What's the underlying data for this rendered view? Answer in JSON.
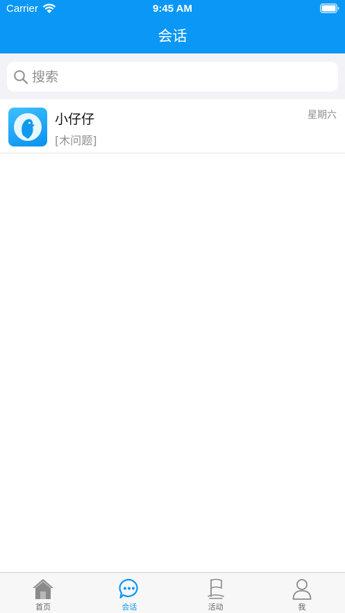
{
  "status_bar": {
    "carrier": "Carrier",
    "time": "9:45 AM",
    "wifi_icon": "wifi-icon",
    "battery_icon": "battery-icon"
  },
  "nav": {
    "title": "会话"
  },
  "search": {
    "placeholder": "搜索",
    "value": "",
    "icon": "search-icon"
  },
  "conversations": [
    {
      "name": "小仔仔",
      "preview": "[木问题]",
      "time": "星期六",
      "avatar_icon": "penguin-avatar-icon"
    }
  ],
  "tabs": [
    {
      "label": "首页",
      "icon": "home-icon",
      "active": false
    },
    {
      "label": "会话",
      "icon": "chat-bubble-icon",
      "active": true
    },
    {
      "label": "活动",
      "icon": "flag-icon",
      "active": false
    },
    {
      "label": "我",
      "icon": "person-icon",
      "active": false
    }
  ],
  "colors": {
    "primary": "#0a97f5",
    "search_bg": "#f2f2f7",
    "tab_bar_bg": "#f7f7f7",
    "secondary_text": "#8e8e93"
  }
}
